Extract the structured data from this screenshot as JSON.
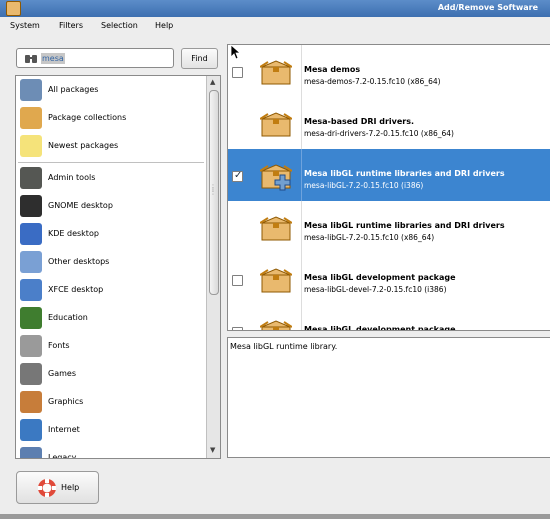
{
  "window": {
    "title": "Add/Remove Software",
    "app_icon": "package-icon"
  },
  "menubar": {
    "items": [
      "System",
      "Filters",
      "Selection",
      "Help"
    ]
  },
  "search": {
    "value": "mesa",
    "find_label": "Find"
  },
  "categories": [
    {
      "label": "All packages",
      "icon": "all-packages-icon",
      "color": "#6d8db5"
    },
    {
      "label": "Package collections",
      "icon": "package-collections-icon",
      "color": "#e0a84e"
    },
    {
      "label": "Newest packages",
      "icon": "lightbulb-icon",
      "color": "#f5e37a"
    },
    {
      "label": "Admin tools",
      "icon": "admin-tools-icon",
      "color": "#555753"
    },
    {
      "label": "GNOME desktop",
      "icon": "gnome-icon",
      "color": "#2e2e2e"
    },
    {
      "label": "KDE desktop",
      "icon": "kde-icon",
      "color": "#3a6cc4"
    },
    {
      "label": "Other desktops",
      "icon": "other-desktops-icon",
      "color": "#7aa0d4"
    },
    {
      "label": "XFCE desktop",
      "icon": "xfce-icon",
      "color": "#4b7fc9"
    },
    {
      "label": "Education",
      "icon": "education-icon",
      "color": "#3f7d2f"
    },
    {
      "label": "Fonts",
      "icon": "fonts-icon",
      "color": "#9a9a9a"
    },
    {
      "label": "Games",
      "icon": "games-icon",
      "color": "#777777"
    },
    {
      "label": "Graphics",
      "icon": "graphics-icon",
      "color": "#c77d3a"
    },
    {
      "label": "Internet",
      "icon": "internet-icon",
      "color": "#3b79c2"
    },
    {
      "label": "Legacy",
      "icon": "legacy-icon",
      "color": "#5d7fb0"
    }
  ],
  "packages": [
    {
      "name": "Mesa demos",
      "version": "mesa-demos-7.2-0.15.fc10 (x86_64)",
      "checked": false,
      "checkbox": true,
      "selected": false,
      "install_overlay": false
    },
    {
      "name": "Mesa-based DRI drivers.",
      "version": "mesa-dri-drivers-7.2-0.15.fc10 (x86_64)",
      "checked": false,
      "checkbox": false,
      "selected": false,
      "install_overlay": false
    },
    {
      "name": "Mesa libGL runtime libraries and DRI drivers",
      "version": "mesa-libGL-7.2-0.15.fc10 (i386)",
      "checked": true,
      "checkbox": true,
      "selected": true,
      "install_overlay": true
    },
    {
      "name": "Mesa libGL runtime libraries and DRI drivers",
      "version": "mesa-libGL-7.2-0.15.fc10 (x86_64)",
      "checked": false,
      "checkbox": false,
      "selected": false,
      "install_overlay": false
    },
    {
      "name": "Mesa libGL development package",
      "version": "mesa-libGL-devel-7.2-0.15.fc10 (i386)",
      "checked": false,
      "checkbox": true,
      "selected": false,
      "install_overlay": false
    },
    {
      "name": "Mesa libGL development package",
      "version": "",
      "checked": false,
      "checkbox": true,
      "selected": false,
      "install_overlay": false
    }
  ],
  "description": {
    "text": "Mesa libGL runtime library."
  },
  "help_button": {
    "label": "Help"
  },
  "colors": {
    "selection": "#3c85d0",
    "title_bar": "#4a7dbf",
    "box": "#e9b96e"
  }
}
